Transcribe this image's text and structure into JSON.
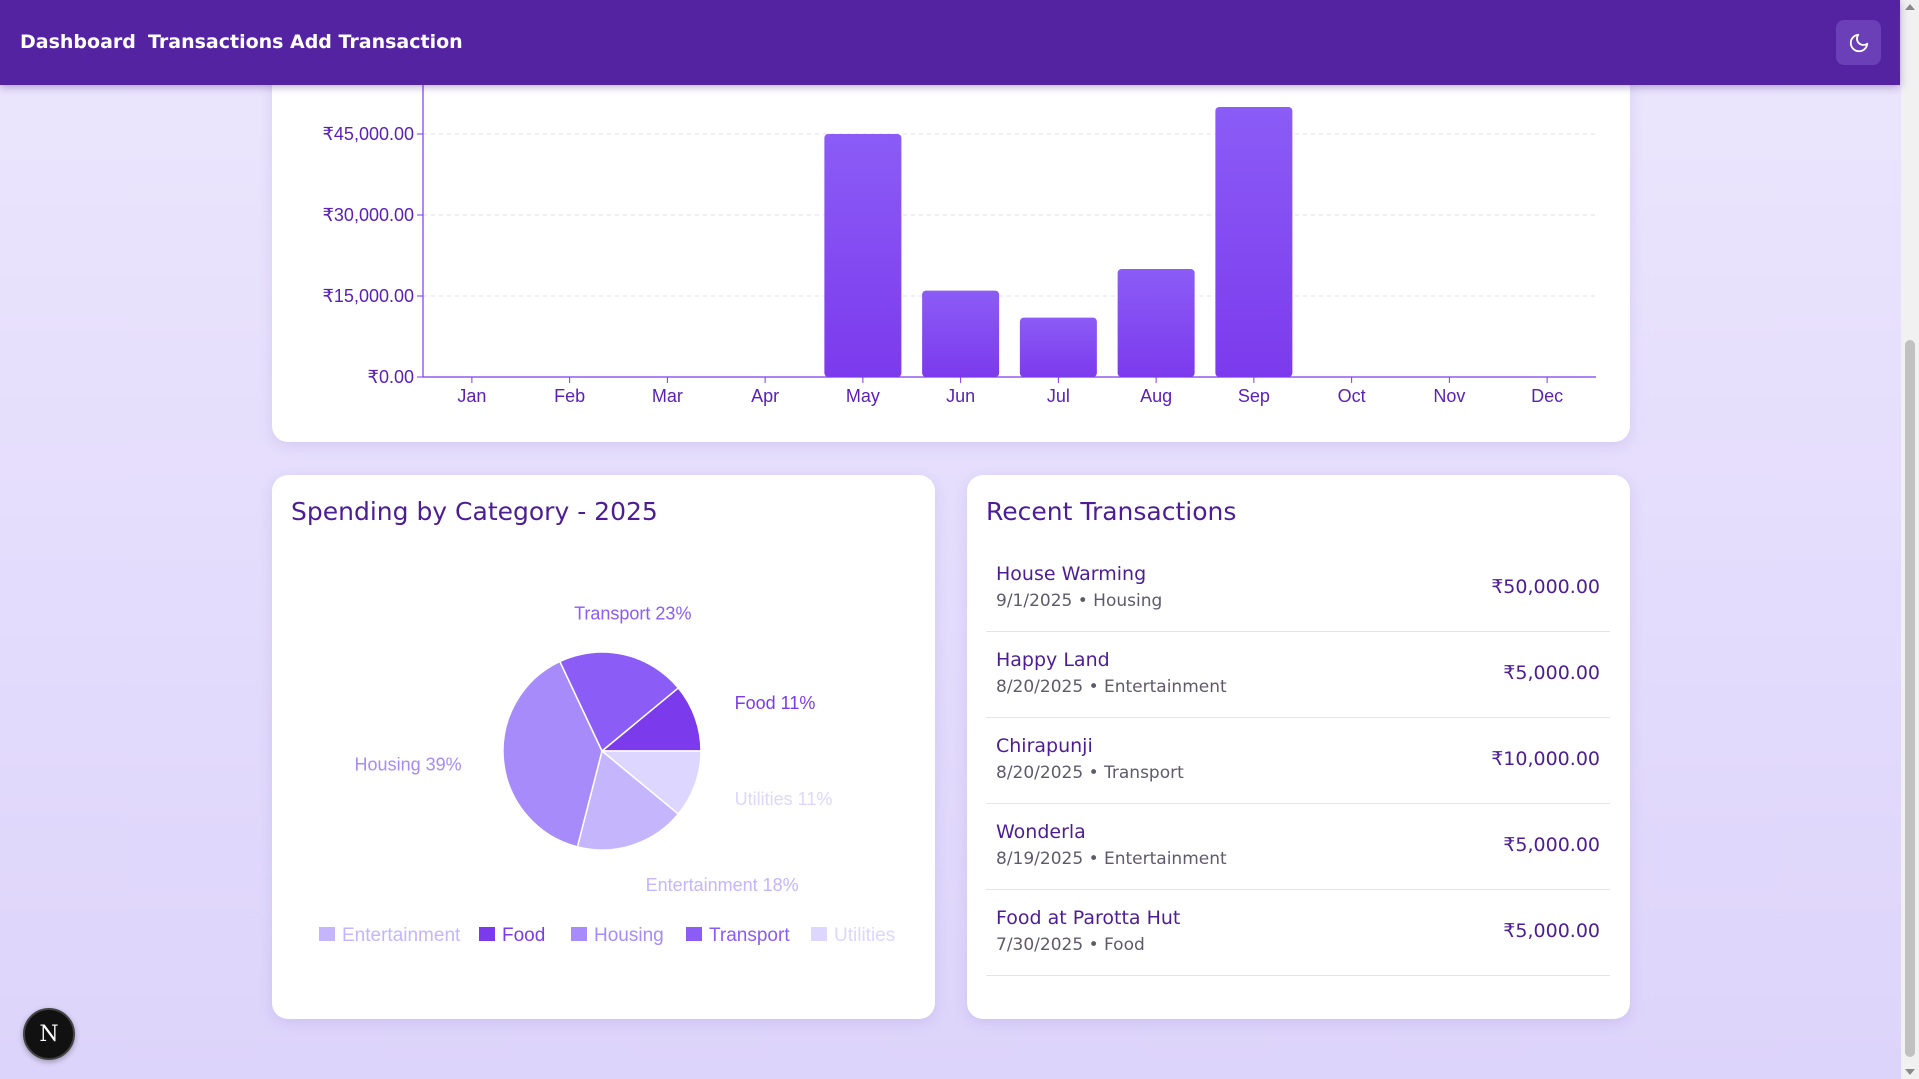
{
  "nav": {
    "links": [
      "Dashboard",
      "Transactions",
      "Add Transaction"
    ],
    "theme_icon": "moon-icon"
  },
  "colors": {
    "nav_bg": "#5423a1",
    "accent": "#7c3aed",
    "text_primary": "#4c1d95"
  },
  "chart_data": [
    {
      "type": "bar",
      "categories": [
        "Jan",
        "Feb",
        "Mar",
        "Apr",
        "May",
        "Jun",
        "Jul",
        "Aug",
        "Sep",
        "Oct",
        "Nov",
        "Dec"
      ],
      "values": [
        0,
        0,
        0,
        0,
        45000,
        16000,
        11000,
        20000,
        50000,
        0,
        0,
        0
      ],
      "yticks": [
        "₹0.00",
        "₹15,000.00",
        "₹30,000.00",
        "₹45,000.00"
      ],
      "ytick_values": [
        0,
        15000,
        30000,
        45000
      ],
      "ylim": [
        0,
        60000
      ],
      "grid": true
    },
    {
      "type": "pie",
      "title": "Spending by Category - 2025",
      "slices": [
        {
          "name": "Food",
          "percent": 11,
          "label": "Food 11%",
          "color": "#7c3aed"
        },
        {
          "name": "Utilities",
          "percent": 11,
          "label": "Utilities 11%",
          "color": "#ddd6fe"
        },
        {
          "name": "Entertainment",
          "percent": 18,
          "label": "Entertainment 18%",
          "color": "#c4b5fd"
        },
        {
          "name": "Housing",
          "percent": 39,
          "label": "Housing 39%",
          "color": "#a78bfa"
        },
        {
          "name": "Transport",
          "percent": 21,
          "label": "Transport 23%",
          "color": "#8b5cf6"
        }
      ],
      "legend": [
        {
          "name": "Entertainment",
          "color": "#c4b5fd"
        },
        {
          "name": "Food",
          "color": "#7c3aed"
        },
        {
          "name": "Housing",
          "color": "#a78bfa"
        },
        {
          "name": "Transport",
          "color": "#8b5cf6"
        },
        {
          "name": "Utilities",
          "color": "#ddd6fe"
        }
      ],
      "legend_position": "bottom"
    }
  ],
  "recent": {
    "title": "Recent Transactions",
    "items": [
      {
        "name": "House Warming",
        "sub": "9/1/2025 • Housing",
        "amount": "₹50,000.00"
      },
      {
        "name": "Happy Land",
        "sub": "8/20/2025 • Entertainment",
        "amount": "₹5,000.00"
      },
      {
        "name": "Chirapunji",
        "sub": "8/20/2025 • Transport",
        "amount": "₹10,000.00"
      },
      {
        "name": "Wonderla",
        "sub": "8/19/2025 • Entertainment",
        "amount": "₹5,000.00"
      },
      {
        "name": "Food at Parotta Hut",
        "sub": "7/30/2025 • Food",
        "amount": "₹5,000.00"
      }
    ]
  },
  "dev_badge": {
    "label": "N"
  }
}
